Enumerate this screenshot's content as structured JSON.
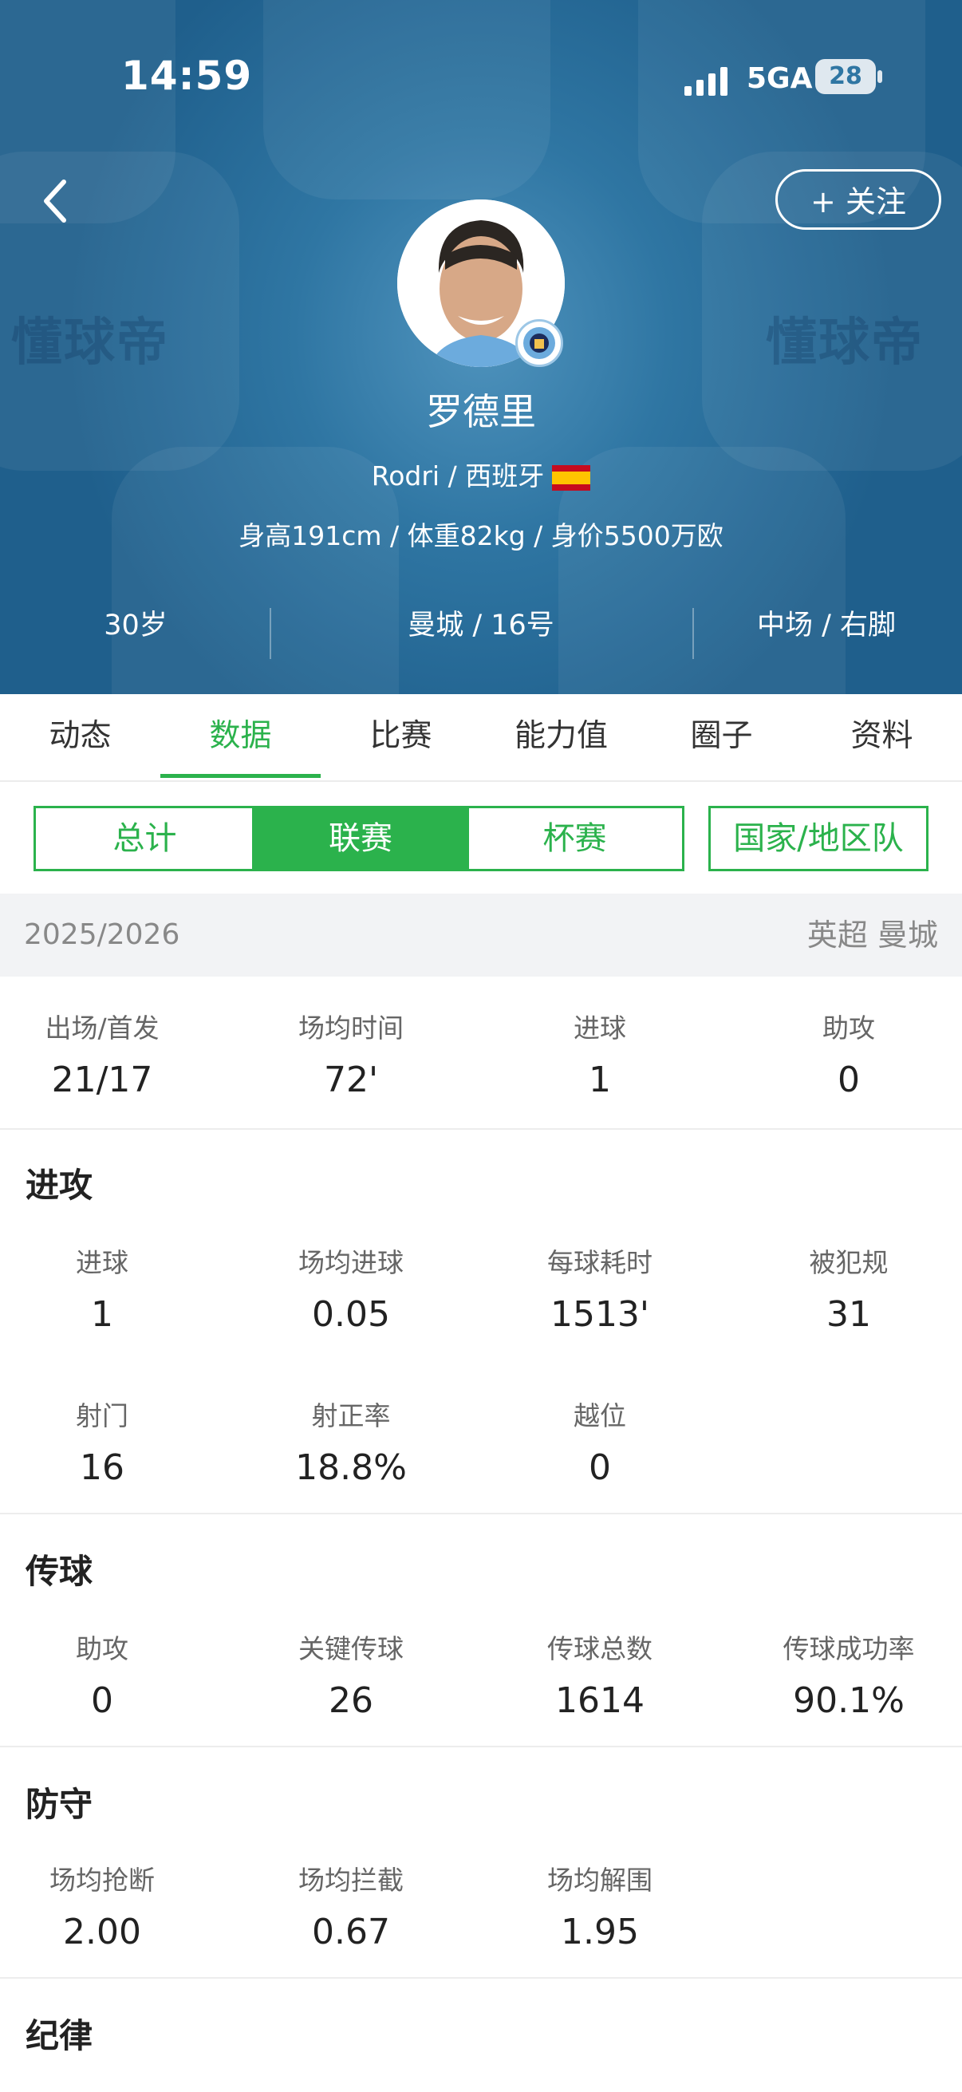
{
  "status_bar": {
    "time": "14:59",
    "network": "5GA",
    "battery": "28"
  },
  "header": {
    "follow_label": "+ 关注",
    "watermark": "懂球帝",
    "player_name": "罗德里",
    "english_name_nation": "Rodri / 西班牙",
    "body_info": "身高191cm / 体重82kg / 身价5500万欧",
    "age": "30岁",
    "club_number": "曼城 / 16号",
    "position_foot": "中场 / 右脚"
  },
  "tabs": [
    "动态",
    "数据",
    "比赛",
    "能力值",
    "圈子",
    "资料"
  ],
  "active_tab": 1,
  "filters": [
    "总计",
    "联赛",
    "杯赛"
  ],
  "active_filter": 1,
  "national_filter": "国家/地区队",
  "season": {
    "year": "2025/2026",
    "competition": "英超 曼城"
  },
  "summary": [
    {
      "label": "出场/首发",
      "value": "21/17"
    },
    {
      "label": "场均时间",
      "value": "72'"
    },
    {
      "label": "进球",
      "value": "1"
    },
    {
      "label": "助攻",
      "value": "0"
    }
  ],
  "attack": {
    "title": "进攻",
    "row1": [
      {
        "label": "进球",
        "value": "1"
      },
      {
        "label": "场均进球",
        "value": "0.05"
      },
      {
        "label": "每球耗时",
        "value": "1513'"
      },
      {
        "label": "被犯规",
        "value": "31"
      }
    ],
    "row2": [
      {
        "label": "射门",
        "value": "16"
      },
      {
        "label": "射正率",
        "value": "18.8%"
      },
      {
        "label": "越位",
        "value": "0"
      }
    ]
  },
  "passing": {
    "title": "传球",
    "row1": [
      {
        "label": "助攻",
        "value": "0"
      },
      {
        "label": "关键传球",
        "value": "26"
      },
      {
        "label": "传球总数",
        "value": "1614"
      },
      {
        "label": "传球成功率",
        "value": "90.1%"
      }
    ]
  },
  "defense": {
    "title": "防守",
    "row1": [
      {
        "label": "场均抢断",
        "value": "2.00"
      },
      {
        "label": "场均拦截",
        "value": "0.67"
      },
      {
        "label": "场均解围",
        "value": "1.95"
      }
    ]
  },
  "discipline": {
    "title": "纪律"
  },
  "colors": {
    "accent_green": "#2bb24c",
    "header_blue": "#2f76a3"
  }
}
